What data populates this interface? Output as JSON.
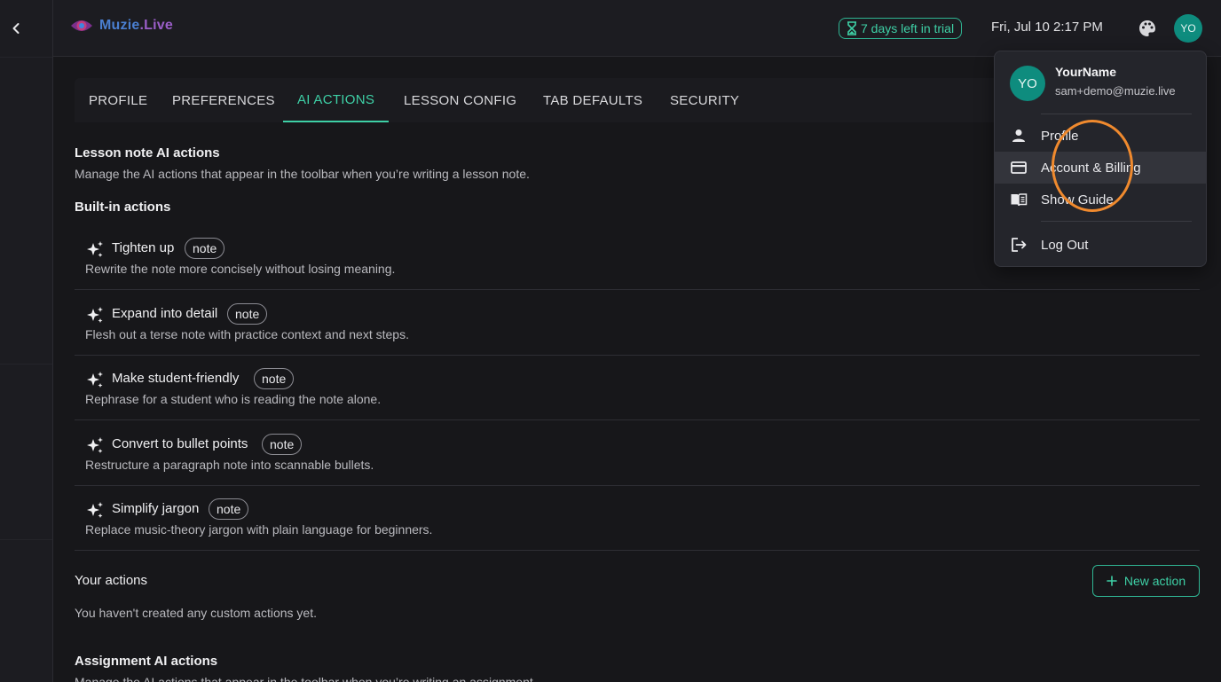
{
  "app": {
    "logo_text_1": "Muzie",
    "logo_text_2": ".Live"
  },
  "header": {
    "trial_label": "7 days left in trial",
    "datetime": "Fri, Jul 10 2:17 PM",
    "avatar_initials": "YO"
  },
  "tabs": [
    {
      "label": "PROFILE"
    },
    {
      "label": "PREFERENCES"
    },
    {
      "label": "AI ACTIONS"
    },
    {
      "label": "LESSON CONFIG"
    },
    {
      "label": "TAB DEFAULTS"
    },
    {
      "label": "SECURITY"
    }
  ],
  "lesson_note": {
    "title": "Lesson note AI actions",
    "description": "Manage the AI actions that appear in the toolbar when you’re writing a lesson note.",
    "builtin_title": "Built-in actions",
    "actions": [
      {
        "name": "Tighten up",
        "tag": "note",
        "description": "Rewrite the note more concisely without losing meaning."
      },
      {
        "name": "Expand into detail",
        "tag": "note",
        "description": "Flesh out a terse note with practice context and next steps."
      },
      {
        "name": "Make student-friendly",
        "tag": "note",
        "description": "Rephrase for a student who is reading the note alone."
      },
      {
        "name": "Convert to bullet points",
        "tag": "note",
        "description": "Restructure a paragraph note into scannable bullets."
      },
      {
        "name": "Simplify jargon",
        "tag": "note",
        "description": "Replace music-theory jargon with plain language for beginners."
      }
    ],
    "your_actions_title": "Your actions",
    "new_action_label": "New action",
    "empty_text": "You haven't created any custom actions yet."
  },
  "assignment": {
    "title": "Assignment AI actions",
    "description": "Manage the AI actions that appear in the toolbar when you’re writing an assignment."
  },
  "menu": {
    "user_name": "YourName",
    "user_email": "sam+demo@muzie.live",
    "avatar_initials": "YO",
    "items": [
      {
        "label": "Profile",
        "icon": "person-icon"
      },
      {
        "label": "Account & Billing",
        "icon": "credit-card-icon"
      },
      {
        "label": "Show Guide",
        "icon": "book-icon"
      },
      {
        "label": "Log Out",
        "icon": "logout-icon"
      }
    ]
  },
  "colors": {
    "accent": "#3ed0a6",
    "avatar": "#0e8c7e",
    "highlight_ring": "#f08a2e"
  }
}
